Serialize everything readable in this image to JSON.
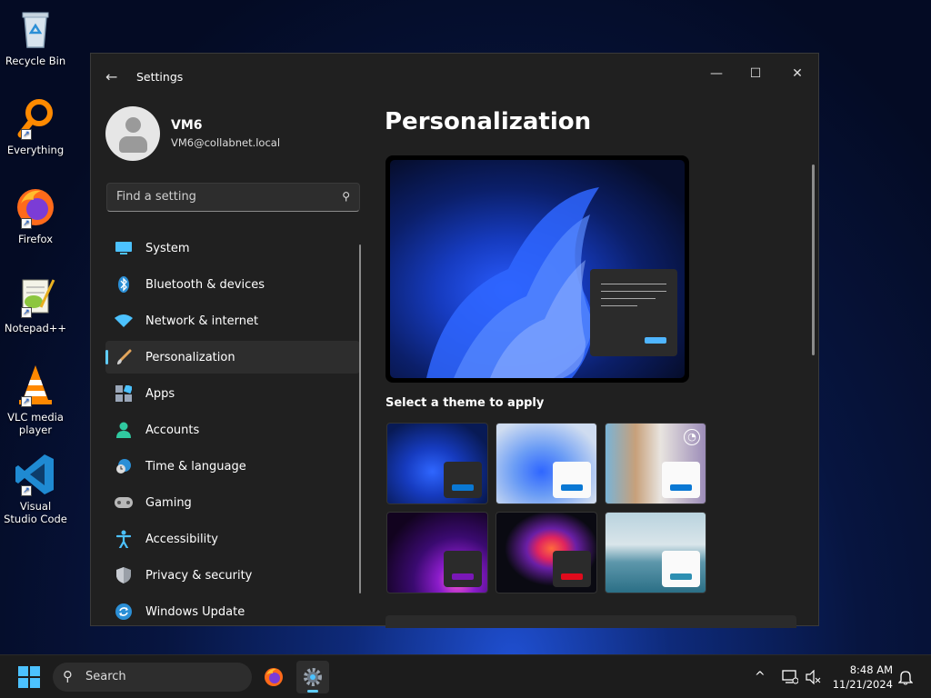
{
  "desktop": {
    "icons": [
      {
        "label": "Recycle Bin"
      },
      {
        "label": "Everything"
      },
      {
        "label": "Firefox"
      },
      {
        "label": "Notepad++"
      },
      {
        "label": "VLC media player"
      },
      {
        "label": "Visual Studio Code"
      }
    ]
  },
  "window": {
    "title": "Settings",
    "controls": {
      "minimize": "—",
      "maximize": "☐",
      "close": "✕"
    }
  },
  "profile": {
    "name": "VM6",
    "email": "VM6@collabnet.local"
  },
  "search": {
    "placeholder": "Find a setting"
  },
  "sidebar": {
    "items": [
      {
        "label": "System"
      },
      {
        "label": "Bluetooth & devices"
      },
      {
        "label": "Network & internet"
      },
      {
        "label": "Personalization",
        "active": true
      },
      {
        "label": "Apps"
      },
      {
        "label": "Accounts"
      },
      {
        "label": "Time & language"
      },
      {
        "label": "Gaming"
      },
      {
        "label": "Accessibility"
      },
      {
        "label": "Privacy & security"
      },
      {
        "label": "Windows Update"
      }
    ]
  },
  "main": {
    "title": "Personalization",
    "theme_heading": "Select a theme to apply",
    "themes": [
      {
        "accent": "#0a78d4"
      },
      {
        "accent": "#0a78d4"
      },
      {
        "accent": "#0a78d4"
      },
      {
        "accent": "#7a17b8"
      },
      {
        "accent": "#e00a1c"
      },
      {
        "accent": "#2d8fb2"
      }
    ]
  },
  "taskbar": {
    "search_label": "Search",
    "time": "8:48 AM",
    "date": "11/21/2024"
  },
  "colors": {
    "accent": "#60cdff",
    "window_bg": "#202020",
    "taskbar_bg": "#1c1c1c"
  }
}
